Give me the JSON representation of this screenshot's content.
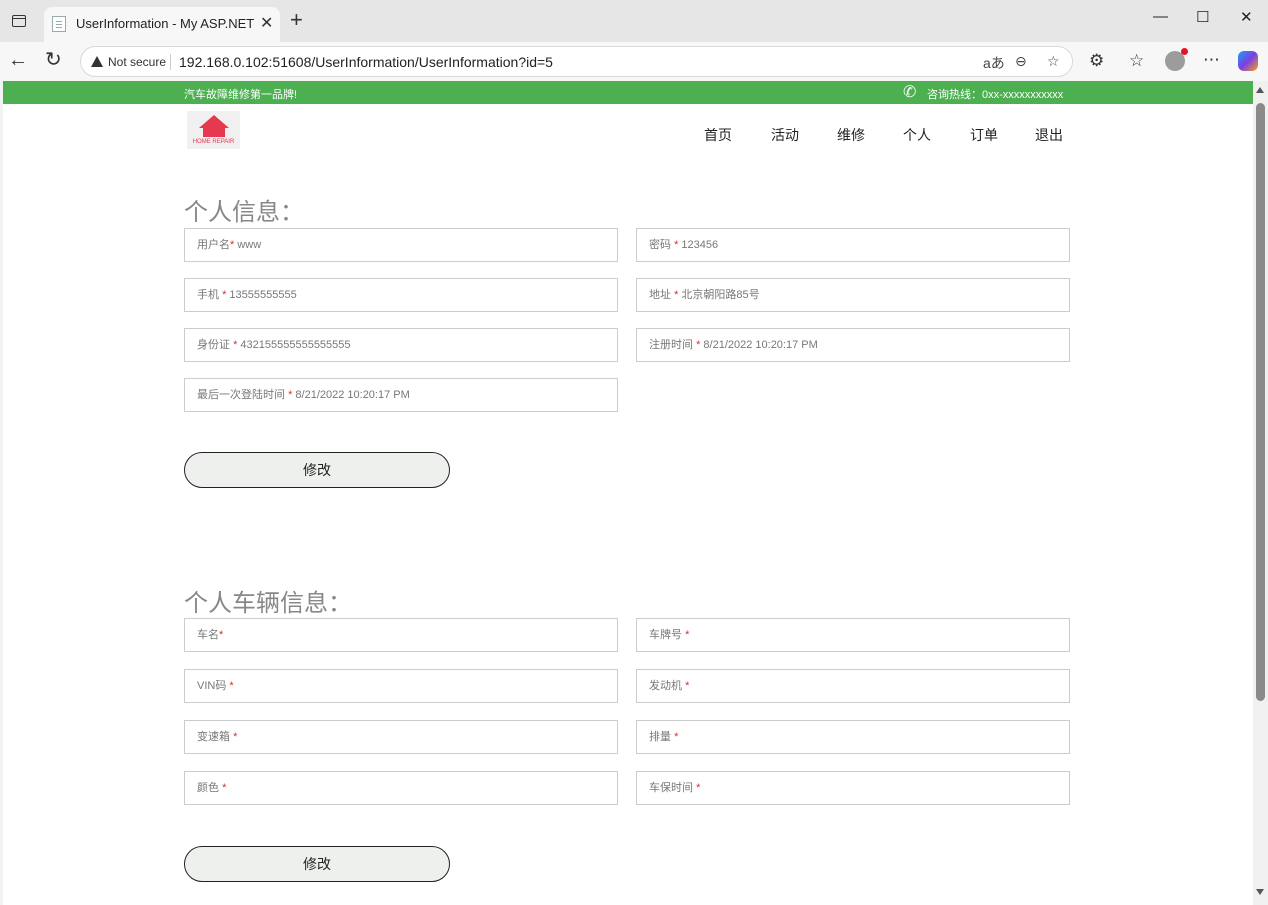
{
  "browser": {
    "tab_title": "UserInformation - My ASP.NET Ap",
    "not_secure": "Not secure",
    "url": "192.168.0.102:51608/UserInformation/UserInformation?id=5"
  },
  "site": {
    "slogan": "汽车故障维修第一品牌!",
    "hotline": "咨询热线：0xx-xxxxxxxxxxx",
    "logo_caption": "HOME REPAIR",
    "nav": [
      "首页",
      "活动",
      "维修",
      "个人",
      "订单",
      "退出"
    ]
  },
  "personal": {
    "title": "个人信息：",
    "fields": [
      {
        "label": "用户名",
        "value": "www"
      },
      {
        "label": "密码 ",
        "value": "123456"
      },
      {
        "label": "手机 ",
        "value": "13555555555"
      },
      {
        "label": "地址 ",
        "value": "北京朝阳路85号"
      },
      {
        "label": "身份证 ",
        "value": "432155555555555555"
      },
      {
        "label": "注册时间 ",
        "value": "8/21/2022 10:20:17 PM"
      },
      {
        "label": "最后一次登陆时间 ",
        "value": "8/21/2022 10:20:17 PM"
      }
    ],
    "button": "修改"
  },
  "vehicle": {
    "title": "个人车辆信息：",
    "fields": [
      {
        "label": "车名",
        "value": ""
      },
      {
        "label": "车牌号 ",
        "value": ""
      },
      {
        "label": "VIN码 ",
        "value": ""
      },
      {
        "label": "发动机 ",
        "value": ""
      },
      {
        "label": "变速箱 ",
        "value": ""
      },
      {
        "label": "排量 ",
        "value": ""
      },
      {
        "label": "颜色 ",
        "value": ""
      },
      {
        "label": "车保时间 ",
        "value": ""
      }
    ],
    "button": "修改"
  },
  "colors": {
    "strip": "#4caf50",
    "required": "#d32f2f"
  }
}
